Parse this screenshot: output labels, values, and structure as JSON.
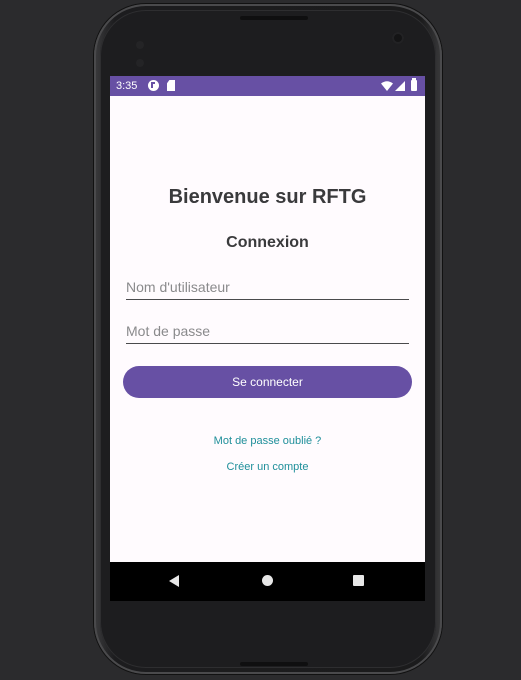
{
  "status_bar": {
    "time": "3:35",
    "icons": [
      "app-notification-icon",
      "sd-card-icon",
      "wifi-icon",
      "cell-signal-icon",
      "battery-icon"
    ],
    "background_color": "#6750a4"
  },
  "login": {
    "title": "Bienvenue sur RFTG",
    "subtitle": "Connexion",
    "username_placeholder": "Nom d'utilisateur",
    "username_value": "",
    "password_placeholder": "Mot de passe",
    "password_value": "",
    "login_button_label": "Se connecter",
    "forgot_password_link": "Mot de passe oublié ?",
    "create_account_link": "Créer un compte"
  },
  "nav_bar": {
    "icons": [
      "back-icon",
      "home-icon",
      "recent-apps-icon"
    ]
  },
  "colors": {
    "accent": "#6750a4",
    "link": "#1f8f9a",
    "screen_background": "#fffbfe"
  }
}
